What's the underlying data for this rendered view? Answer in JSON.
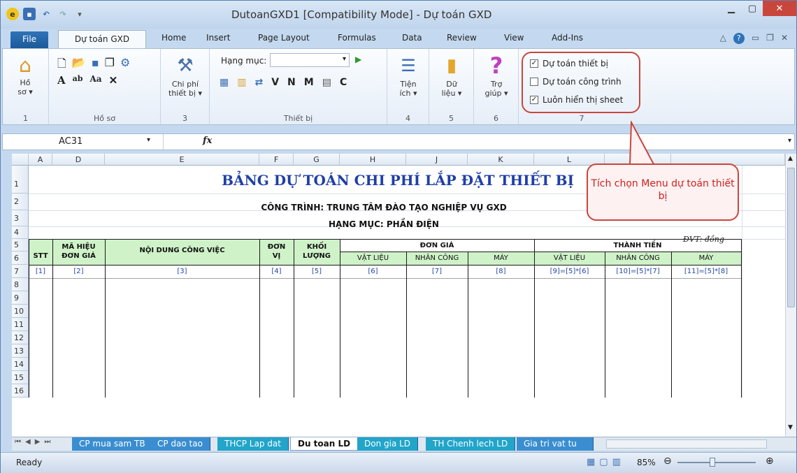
{
  "window": {
    "title": "DutoanGXD1  [Compatibility Mode]  -  Dự toán GXD"
  },
  "ribbon_tabs": [
    "File",
    "Dự toán GXD",
    "Home",
    "Insert",
    "Page Layout",
    "Formulas",
    "Data",
    "Review",
    "View",
    "Add-Ins"
  ],
  "ribbon": {
    "ho_so": {
      "label": "Hồ\nsơ ▾",
      "group": "Hồ sơ",
      "num": "1"
    },
    "chi_phi": {
      "label": "Chi phí\nthiết bị ▾",
      "num": "3"
    },
    "hang_muc_label": "Hạng mục:",
    "thiet_bi_letters": [
      "V",
      "N",
      "M",
      "C"
    ],
    "thiet_bi_group": "Thiết bị",
    "tien_ich": {
      "label": "Tiện\ních ▾",
      "num": "4"
    },
    "du_lieu": {
      "label": "Dữ\nliệu ▾",
      "num": "5"
    },
    "tro_giup": {
      "label": "Trợ\ngiúp ▾",
      "num": "6"
    },
    "group7_num": "7",
    "checkboxes": [
      {
        "label": "Dự toán thiết bị",
        "checked": true
      },
      {
        "label": "Dự toán công trình",
        "checked": false
      },
      {
        "label": "Luôn hiển thị sheet",
        "checked": true
      }
    ]
  },
  "formula_bar": {
    "name_box": "AC31",
    "fx": "fx",
    "formula": ""
  },
  "columns": [
    "A",
    "D",
    "E",
    "F",
    "G",
    "H",
    "J",
    "K",
    "L",
    "",
    ""
  ],
  "rows": [
    "1",
    "2",
    "3",
    "4",
    "5",
    "6",
    "7",
    "8",
    "9",
    "10",
    "11",
    "12",
    "13",
    "14",
    "15",
    "16"
  ],
  "sheet": {
    "title": "BẢNG DỰ TOÁN CHI PHÍ LẮP ĐẶT THIẾT BỊ",
    "project": "CÔNG TRÌNH: TRUNG TÂM ĐÀO TẠO NGHIỆP VỤ GXD",
    "item": "HẠNG MỤC: PHẦN ĐIỆN",
    "unit_note": "ĐVT: đồng",
    "headers": {
      "stt": "STT",
      "ma_hieu": "MÃ HIỆU ĐƠN GIÁ",
      "noi_dung": "NỘI DUNG CÔNG VIỆC",
      "don_vi": "ĐƠN VỊ",
      "khoi_luong": "KHỐI LƯỢNG",
      "don_gia": "ĐƠN GIÁ",
      "thanh_tien": "THÀNH TIỀN",
      "vat_lieu": "VẬT LIỆU",
      "nhan_cong": "NHÂN CÔNG",
      "may": "MÁY"
    },
    "index_row": [
      "[1]",
      "[2]",
      "[3]",
      "[4]",
      "[5]",
      "[6]",
      "[7]",
      "[8]",
      "[9]=[5]*[6]",
      "[10]=[5]*[7]",
      "[11]=[5]*[8]"
    ]
  },
  "callout": "Tích chọn Menu dự toán thiết bị",
  "sheet_tabs": [
    "CP mua sam TB",
    "CP dao tao",
    "THCP Lap dat",
    "Du toan LD",
    "Don gia LD",
    "TH Chenh lech LD",
    "Gia tri vat tu"
  ],
  "active_sheet": "Du toan LD",
  "status": {
    "ready": "Ready",
    "zoom": "85%"
  },
  "colors": {
    "accent": "#1f3fa8",
    "callout": "#c9463d",
    "header_fill": "#cff2c8"
  }
}
